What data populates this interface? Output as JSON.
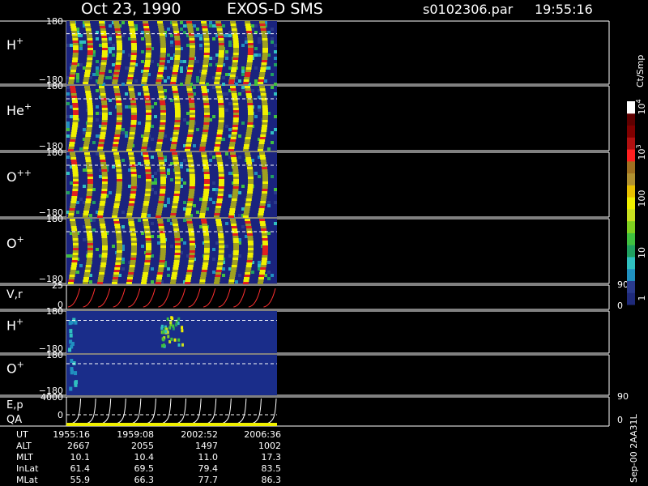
{
  "header": {
    "date": "Oct 23, 1990",
    "instrument": "EXOS-D SMS",
    "file": "s0102306.par",
    "time": "19:55:16"
  },
  "footer_stamp": "Sep-00 2AA31L",
  "colorbar": {
    "unit": "Ct/Smp",
    "ticks": [
      "1",
      "10",
      "100",
      "10",
      "10"
    ],
    "tick_exps": [
      "",
      "",
      "",
      "3",
      "4"
    ],
    "colors": [
      "#1f2a7a",
      "#2a3a8c",
      "#2090c0",
      "#30c0c0",
      "#20a060",
      "#40c040",
      "#80d020",
      "#c8e020",
      "#f0f000",
      "#e8c000",
      "#b09030",
      "#a07020",
      "#ff2020",
      "#b01010",
      "#800000",
      "#600000",
      "#ffffff"
    ]
  },
  "chart_data": [
    {
      "type": "heatmap",
      "panels": [
        {
          "label": "H",
          "sup": "+",
          "ymax": "180",
          "ymin": "−180",
          "intensity": 0.9
        },
        {
          "label": "He",
          "sup": "+",
          "ymax": "180",
          "ymin": "−180",
          "intensity": 0.6
        },
        {
          "label": "O",
          "sup": "++",
          "ymax": "180",
          "ymin": "−180",
          "intensity": 0.65
        },
        {
          "label": "O",
          "sup": "+",
          "ymax": "180",
          "ymin": "−180",
          "intensity": 0.6
        }
      ],
      "n_spin_stripes": 14
    },
    {
      "type": "line",
      "panel": {
        "label": "V,r",
        "ymax": "25",
        "ymin": "0",
        "right_top": "90",
        "right_bottom": "0"
      },
      "n_cycles": 14
    },
    {
      "type": "heatmap",
      "panels": [
        {
          "label": "H",
          "sup": "+",
          "ymax": "180",
          "ymin": "−180"
        },
        {
          "label": "O",
          "sup": "+",
          "ymax": "180",
          "ymin": "−180"
        }
      ]
    },
    {
      "type": "line",
      "panel": {
        "label": "E,p",
        "label2": "QA",
        "ymax": "4000",
        "ymin": "0",
        "right_top": "90",
        "right_bottom": "0"
      },
      "n_cycles": 14
    },
    {
      "type": "table",
      "rows": [
        {
          "name": "UT",
          "values": [
            "1955:16",
            "1959:08",
            "2002:52",
            "2006:36"
          ]
        },
        {
          "name": "ALT",
          "values": [
            "2667",
            "2055",
            "1497",
            "1002"
          ]
        },
        {
          "name": "MLT",
          "values": [
            "10.1",
            "10.4",
            "11.0",
            "17.3"
          ]
        },
        {
          "name": "InLat",
          "values": [
            "61.4",
            "69.5",
            "79.4",
            "83.5"
          ]
        },
        {
          "name": "MLat",
          "values": [
            "55.9",
            "66.3",
            "77.7",
            "86.3"
          ]
        }
      ]
    }
  ]
}
